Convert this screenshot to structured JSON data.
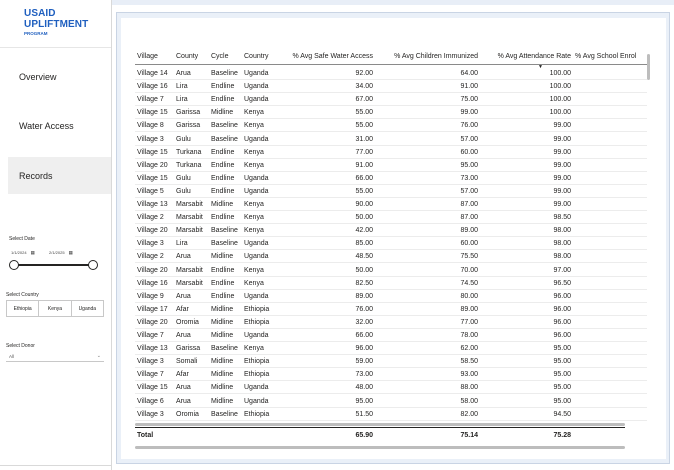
{
  "app": {
    "logo_line1": "USAID",
    "logo_line2": "UPLIFTMENT",
    "logo_sub": "PROGRAM"
  },
  "nav": {
    "overview": "Overview",
    "water_access": "Water Access",
    "records": "Records"
  },
  "filters": {
    "date_label": "Select Date",
    "date_start": "1/1/2024",
    "date_end": "2/1/2025",
    "country_label": "Select Country",
    "countries": [
      "Ethiopia",
      "Kenya",
      "Uganda"
    ],
    "donor_label": "Select Donor",
    "donor_value": "All"
  },
  "table": {
    "headers": {
      "village": "Village",
      "county": "County",
      "cycle": "Cycle",
      "country": "Country",
      "water": "% Avg Safe Water Access",
      "immun": "% Avg Children Immunized",
      "attend": "% Avg Attendance Rate",
      "school": "% Avg School Enrol"
    },
    "sort_indicator": "▼",
    "rows": [
      [
        "Village 14",
        "Arua",
        "Baseline",
        "Uganda",
        "92.00",
        "64.00",
        "100.00"
      ],
      [
        "Village 16",
        "Lira",
        "Endline",
        "Uganda",
        "34.00",
        "91.00",
        "100.00"
      ],
      [
        "Village 7",
        "Lira",
        "Endline",
        "Uganda",
        "67.00",
        "75.00",
        "100.00"
      ],
      [
        "Village 15",
        "Garissa",
        "Midline",
        "Kenya",
        "55.00",
        "99.00",
        "100.00"
      ],
      [
        "Village 8",
        "Garissa",
        "Baseline",
        "Kenya",
        "55.00",
        "76.00",
        "99.00"
      ],
      [
        "Village 3",
        "Gulu",
        "Baseline",
        "Uganda",
        "31.00",
        "57.00",
        "99.00"
      ],
      [
        "Village 15",
        "Turkana",
        "Endline",
        "Kenya",
        "77.00",
        "60.00",
        "99.00"
      ],
      [
        "Village 20",
        "Turkana",
        "Endline",
        "Kenya",
        "91.00",
        "95.00",
        "99.00"
      ],
      [
        "Village 15",
        "Gulu",
        "Endline",
        "Uganda",
        "66.00",
        "73.00",
        "99.00"
      ],
      [
        "Village 5",
        "Gulu",
        "Endline",
        "Uganda",
        "55.00",
        "57.00",
        "99.00"
      ],
      [
        "Village 13",
        "Marsabit",
        "Midline",
        "Kenya",
        "90.00",
        "87.00",
        "99.00"
      ],
      [
        "Village 2",
        "Marsabit",
        "Endline",
        "Kenya",
        "50.00",
        "87.00",
        "98.50"
      ],
      [
        "Village 20",
        "Marsabit",
        "Baseline",
        "Kenya",
        "42.00",
        "89.00",
        "98.00"
      ],
      [
        "Village 3",
        "Lira",
        "Baseline",
        "Uganda",
        "85.00",
        "60.00",
        "98.00"
      ],
      [
        "Village 2",
        "Arua",
        "Midline",
        "Uganda",
        "48.50",
        "75.50",
        "98.00"
      ],
      [
        "Village 20",
        "Marsabit",
        "Endline",
        "Kenya",
        "50.00",
        "70.00",
        "97.00"
      ],
      [
        "Village 16",
        "Marsabit",
        "Endline",
        "Kenya",
        "82.50",
        "74.50",
        "96.50"
      ],
      [
        "Village 9",
        "Arua",
        "Endline",
        "Uganda",
        "89.00",
        "80.00",
        "96.00"
      ],
      [
        "Village 17",
        "Afar",
        "Midline",
        "Ethiopia",
        "76.00",
        "89.00",
        "96.00"
      ],
      [
        "Village 20",
        "Oromia",
        "Midline",
        "Ethiopia",
        "32.00",
        "77.00",
        "96.00"
      ],
      [
        "Village 7",
        "Arua",
        "Midline",
        "Uganda",
        "66.00",
        "78.00",
        "96.00"
      ],
      [
        "Village 13",
        "Garissa",
        "Baseline",
        "Kenya",
        "96.00",
        "62.00",
        "95.00"
      ],
      [
        "Village 3",
        "Somali",
        "Midline",
        "Ethiopia",
        "59.00",
        "58.50",
        "95.00"
      ],
      [
        "Village 7",
        "Afar",
        "Midline",
        "Ethiopia",
        "73.00",
        "93.00",
        "95.00"
      ],
      [
        "Village 15",
        "Arua",
        "Midline",
        "Uganda",
        "48.00",
        "88.00",
        "95.00"
      ],
      [
        "Village 6",
        "Arua",
        "Midline",
        "Uganda",
        "95.00",
        "58.00",
        "95.00"
      ],
      [
        "Village 3",
        "Oromia",
        "Baseline",
        "Ethiopia",
        "51.50",
        "82.00",
        "94.50"
      ]
    ],
    "total": {
      "label": "Total",
      "water": "65.90",
      "immun": "75.14",
      "attend": "75.28"
    }
  }
}
